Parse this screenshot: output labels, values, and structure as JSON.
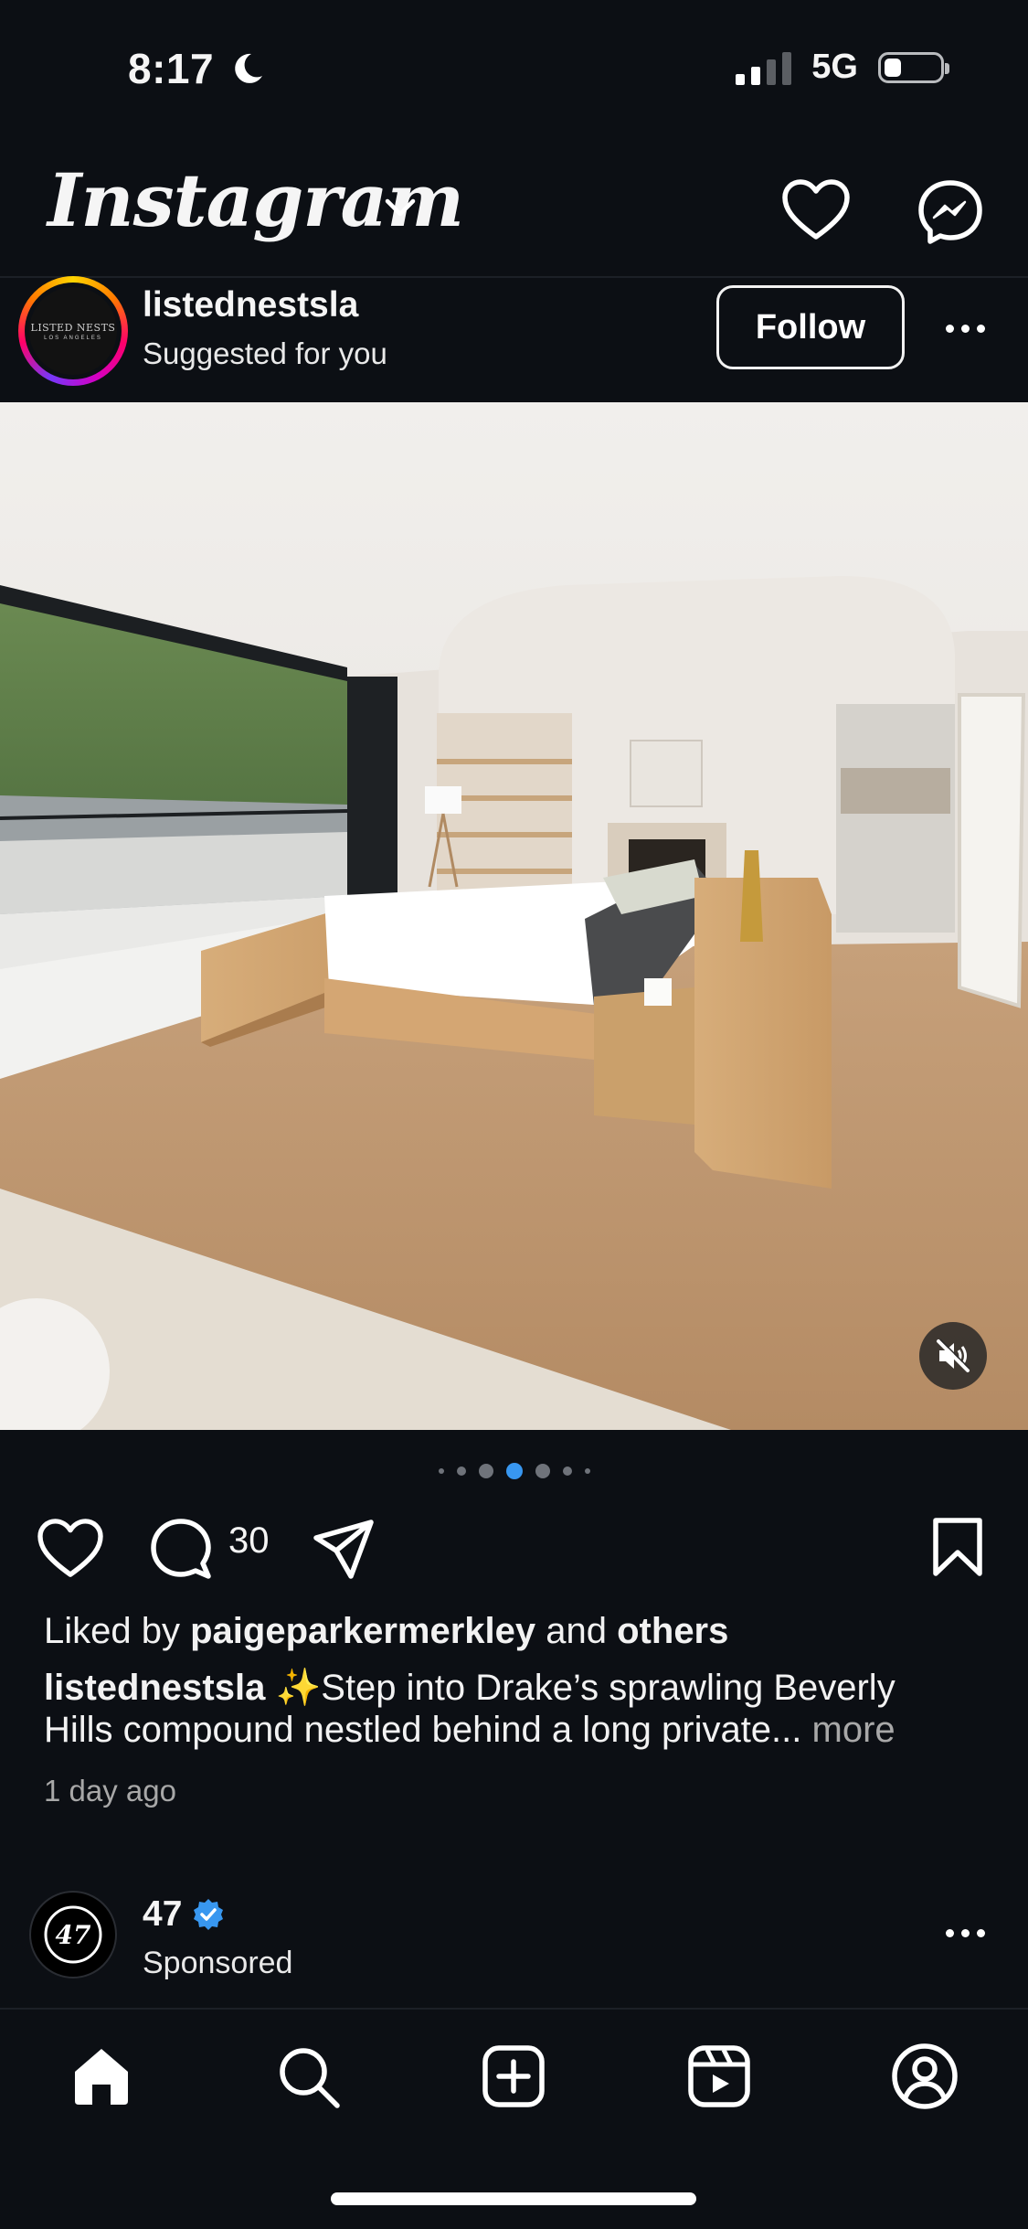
{
  "status_bar": {
    "time": "8:17",
    "network": "5G"
  },
  "header": {
    "logo": "Instagram"
  },
  "post": {
    "account": "listednestsla",
    "subtitle": "Suggested for you",
    "avatar_text": "LISTED NESTS",
    "avatar_subtext": "LOS ANGELES",
    "follow_label": "Follow",
    "comment_count": "30",
    "liked_prefix": "Liked by",
    "liked_user": "paigeparkermerkley",
    "liked_and": "and",
    "liked_others": "others",
    "caption_user": "listednestsla",
    "caption_line1": "✨Step into Drake’s sprawling Beverly",
    "caption_line2": "Hills compound nestled behind a long private...",
    "more_label": "more",
    "time_ago": "1 day ago",
    "carousel": {
      "count": 7,
      "active": 3
    }
  },
  "sponsored": {
    "account": "47",
    "avatar_text": "47",
    "label": "Sponsored"
  },
  "colors": {
    "background": "#0c0f14",
    "accent_blue": "#3897f0",
    "muted_text": "#a8a8a8"
  }
}
